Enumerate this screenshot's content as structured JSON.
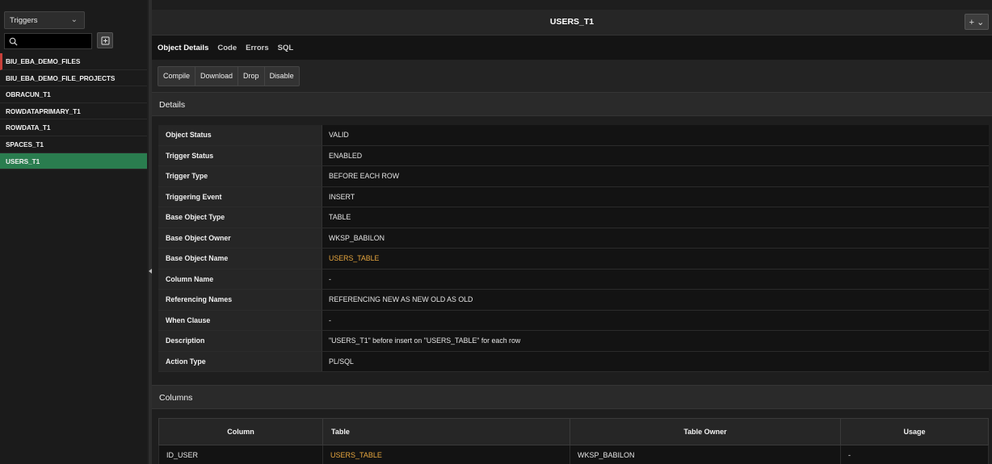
{
  "sidebar": {
    "object_type": "Triggers",
    "search_placeholder": "",
    "items": [
      {
        "label": "BIU_EBA_DEMO_FILES",
        "active": false
      },
      {
        "label": "BIU_EBA_DEMO_FILE_PROJECTS",
        "active": false
      },
      {
        "label": "OBRACUN_T1",
        "active": false
      },
      {
        "label": "ROWDATAPRIMARY_T1",
        "active": false
      },
      {
        "label": "ROWDATA_T1",
        "active": false
      },
      {
        "label": "SPACES_T1",
        "active": false
      },
      {
        "label": "USERS_T1",
        "active": true
      }
    ]
  },
  "header": {
    "title": "USERS_T1",
    "plus_label": "+ ⌄"
  },
  "tabs": [
    "Object Details",
    "Code",
    "Errors",
    "SQL"
  ],
  "toolbar": {
    "compile": "Compile",
    "download": "Download",
    "drop": "Drop",
    "disable": "Disable"
  },
  "details": {
    "heading": "Details",
    "rows": [
      {
        "label": "Object Status",
        "value": "VALID"
      },
      {
        "label": "Trigger Status",
        "value": "ENABLED"
      },
      {
        "label": "Trigger Type",
        "value": "BEFORE EACH ROW"
      },
      {
        "label": "Triggering Event",
        "value": "INSERT"
      },
      {
        "label": "Base Object Type",
        "value": "TABLE"
      },
      {
        "label": "Base Object Owner",
        "value": "WKSP_BABILON"
      },
      {
        "label": "Base Object Name",
        "value": "USERS_TABLE"
      },
      {
        "label": "Column Name",
        "value": "-"
      },
      {
        "label": "Referencing Names",
        "value": "REFERENCING NEW AS NEW OLD AS OLD"
      },
      {
        "label": "When Clause",
        "value": "-"
      },
      {
        "label": "Description",
        "value": "\"USERS_T1\" before insert on \"USERS_TABLE\" for each row"
      },
      {
        "label": "Action Type",
        "value": "PL/SQL"
      }
    ]
  },
  "columns": {
    "heading": "Columns",
    "headers": [
      "Column",
      "Table",
      "Table Owner",
      "Usage"
    ],
    "rows": [
      {
        "column": "ID_USER",
        "table": "USERS_TABLE",
        "owner": "WKSP_BABILON",
        "usage": "-"
      }
    ]
  },
  "colors": {
    "active_item": "#2a7d4f",
    "link": "#e8a73e",
    "error_marker": "#c7403a"
  }
}
